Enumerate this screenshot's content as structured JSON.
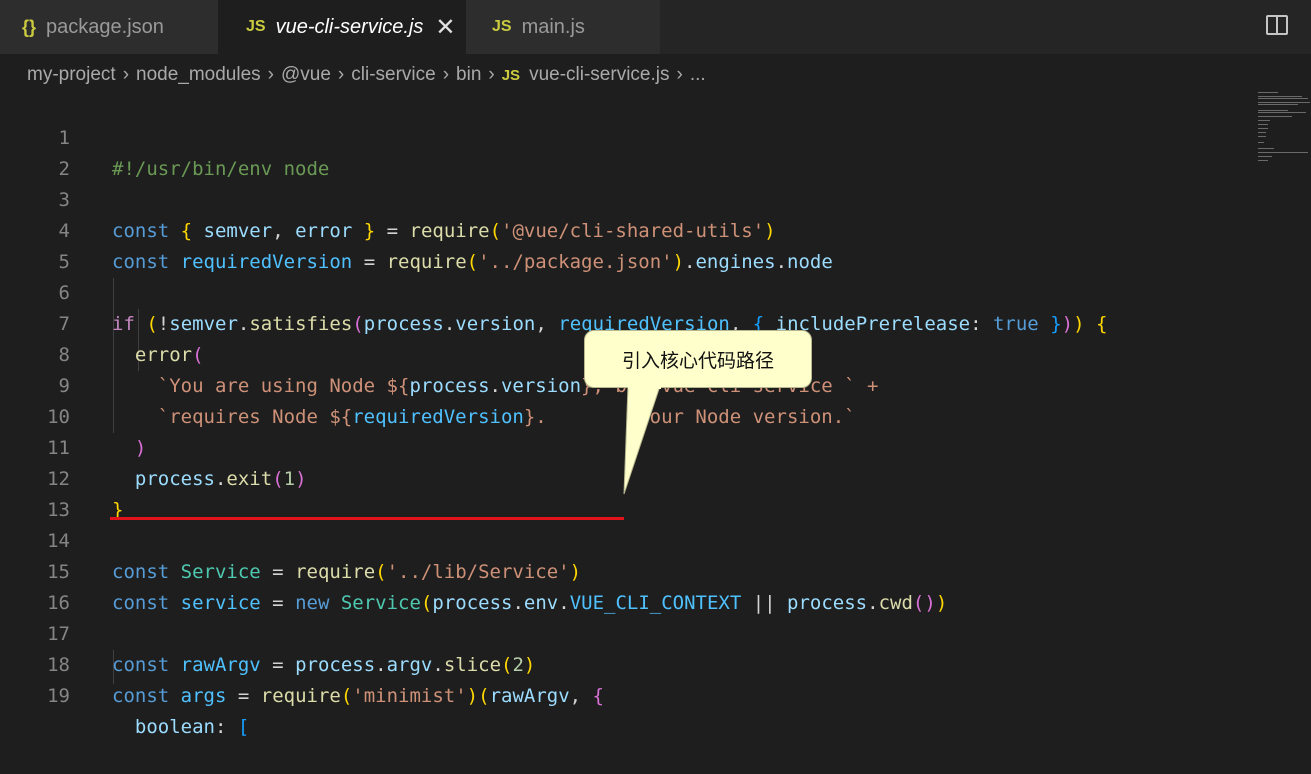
{
  "tabs": [
    {
      "icon": "{}",
      "label": "package.json"
    },
    {
      "icon": "JS",
      "label": "vue-cli-service.js",
      "close": "✕"
    },
    {
      "icon": "JS",
      "label": "main.js"
    }
  ],
  "breadcrumb": {
    "items": [
      "my-project",
      "node_modules",
      "@vue",
      "cli-service",
      "bin"
    ],
    "file_icon": "JS",
    "file": "vue-cli-service.js",
    "more": "..."
  },
  "separator": "›",
  "line_numbers": [
    "1",
    "2",
    "3",
    "4",
    "5",
    "6",
    "7",
    "8",
    "9",
    "10",
    "11",
    "12",
    "13",
    "14",
    "15",
    "16",
    "17",
    "18",
    "19"
  ],
  "code": {
    "l1": "#!/usr/bin/env node",
    "const": "const",
    "lbrace": "{ ",
    "rbrace": " }",
    "semver": "semver",
    "comma": ", ",
    "error": "error",
    "eq": " = ",
    "require": "require",
    "lp": "(",
    "rp": ")",
    "shared_utils": "'@vue/cli-shared-utils'",
    "requiredVersion": "requiredVersion",
    "pkg": "'../package.json'",
    "dot": ".",
    "engines": "engines",
    "node": "node",
    "if": "if",
    "not": "!",
    "satisfies": "satisfies",
    "process": "process",
    "version": "version",
    "includePrerelease": "includePrerelease",
    "colon": ": ",
    "true": "true",
    "open_block": " {",
    "l8_a": "`You are using Node ${",
    "l8_b": "}, but vue-cli-service ` +",
    "l9_a": "`requires Node ${",
    "l9_b": "}.",
    "l9_c": "our Node version.`",
    "exit": "exit",
    "one": "1",
    "close_block": "}",
    "Service": "Service",
    "lib_service": "'../lib/Service'",
    "service": "service",
    "new": "new",
    "env": "env",
    "VUE_CLI_CONTEXT": "VUE_CLI_CONTEXT",
    "or": " || ",
    "cwd": "cwd",
    "rawArgv": "rawArgv",
    "argv": "argv",
    "slice": "slice",
    "two": "2",
    "args": "args",
    "minimist": "'minimist'",
    "boolean": "boolean",
    "lbracket": "["
  },
  "callout": {
    "text": "引入核心代码路径"
  },
  "colors": {
    "underline": "#e0141a",
    "callout_bg": "#ffffcc"
  }
}
